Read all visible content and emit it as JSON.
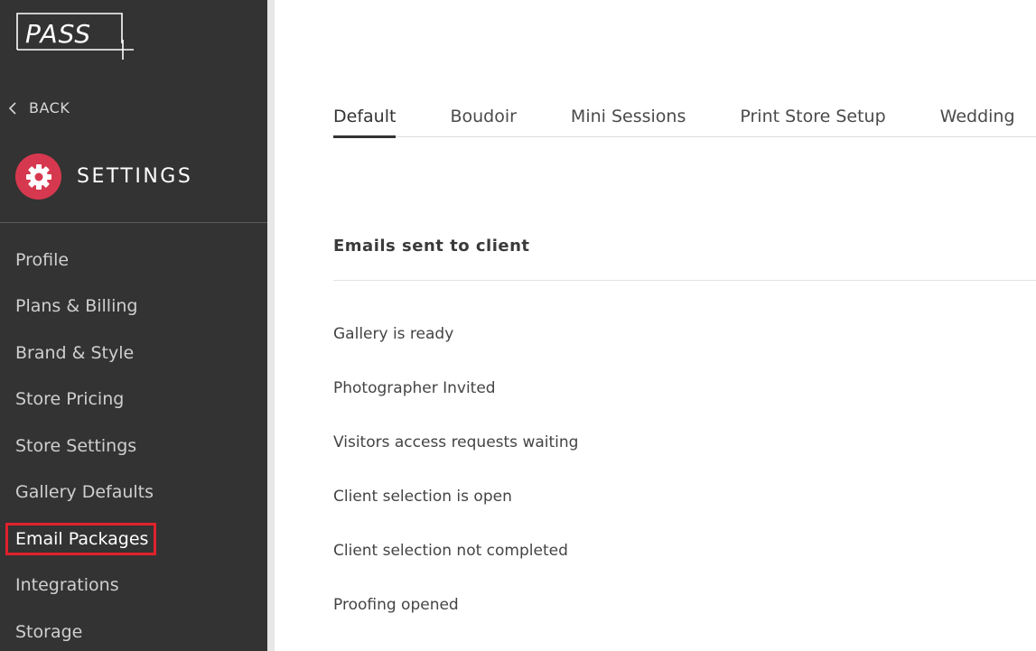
{
  "app": {
    "logo_text": "PASS+"
  },
  "sidebar": {
    "back_label": "BACK",
    "section_title": "SETTINGS",
    "items": [
      {
        "label": "Profile"
      },
      {
        "label": "Plans & Billing"
      },
      {
        "label": "Brand & Style"
      },
      {
        "label": "Store Pricing"
      },
      {
        "label": "Store Settings"
      },
      {
        "label": "Gallery Defaults"
      },
      {
        "label": "Email Packages",
        "active": true
      },
      {
        "label": "Integrations"
      },
      {
        "label": "Storage"
      }
    ]
  },
  "main": {
    "tabs": [
      {
        "label": "Default",
        "active": true
      },
      {
        "label": "Boudoir"
      },
      {
        "label": "Mini Sessions"
      },
      {
        "label": "Print Store Setup"
      },
      {
        "label": "Wedding"
      }
    ],
    "section_title": "Emails sent to client",
    "emails": [
      {
        "label": "Gallery is ready"
      },
      {
        "label": "Photographer Invited"
      },
      {
        "label": "Visitors access requests waiting"
      },
      {
        "label": "Client selection is open"
      },
      {
        "label": "Client selection not completed"
      },
      {
        "label": "Proofing opened"
      }
    ]
  },
  "colors": {
    "sidebar_bg": "#333333",
    "accent": "#d6394f",
    "highlight_outline": "#e0222c"
  }
}
